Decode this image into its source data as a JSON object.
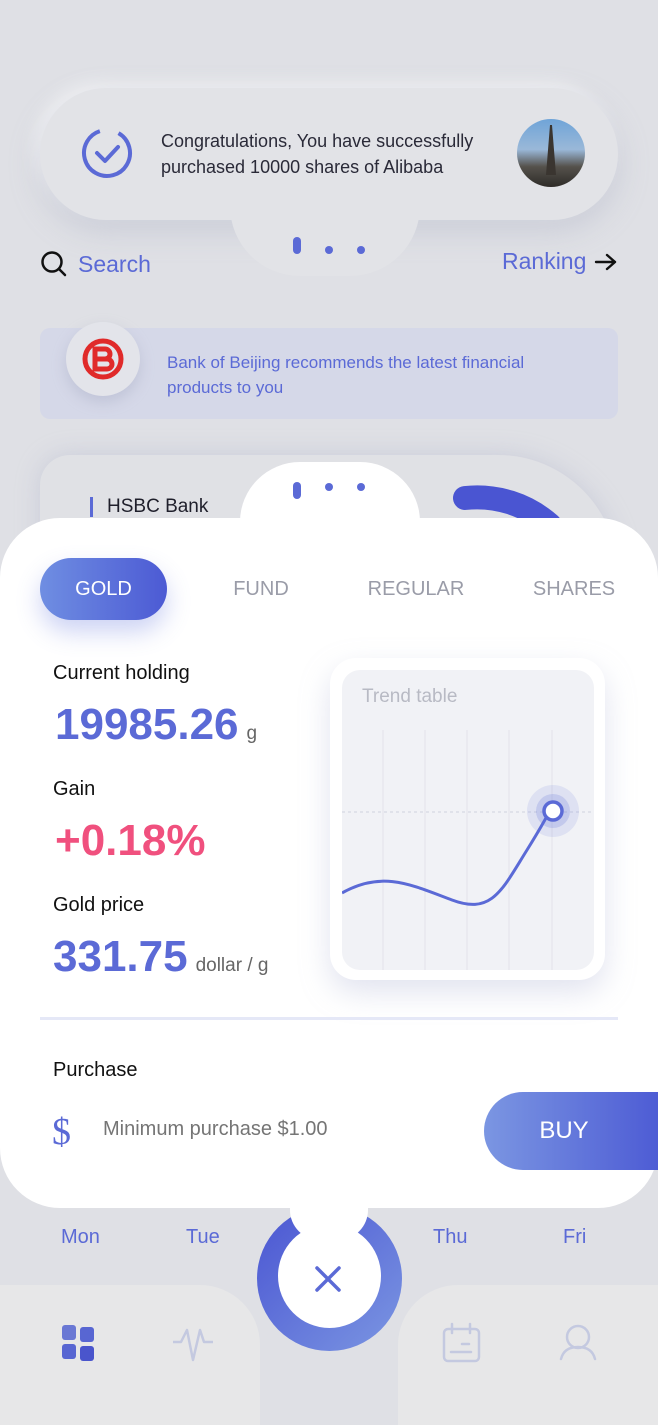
{
  "notification": {
    "message_line1": "Congratulations, You have successfully",
    "message_line2": "purchased 10000 shares of Alibaba",
    "icon": "check-circle-icon"
  },
  "search": {
    "label": "Search"
  },
  "ranking": {
    "label": "Ranking"
  },
  "banner": {
    "text": "Bank of Beijing recommends the latest financial products to you"
  },
  "card_behind": {
    "bank": "HSBC Bank"
  },
  "tabs": [
    {
      "label": "GOLD",
      "active": true
    },
    {
      "label": "FUND"
    },
    {
      "label": "REGULAR"
    },
    {
      "label": "SHARES"
    }
  ],
  "holding": {
    "label": "Current holding",
    "value": "19985.26",
    "unit": "g"
  },
  "gain": {
    "label": "Gain",
    "value": "+0.18%",
    "color": "#f0507e"
  },
  "price": {
    "label": "Gold price",
    "value": "331.75",
    "unit": "dollar / g"
  },
  "trend": {
    "title": "Trend table"
  },
  "purchase": {
    "label": "Purchase",
    "currency": "$",
    "placeholder": "Minimum purchase $1.00",
    "buy": "BUY"
  },
  "days": [
    "Mon",
    "Tue",
    "Thu",
    "Fri"
  ],
  "colors": {
    "accent": "#5b6ad6",
    "background": "#dfe0e5"
  }
}
